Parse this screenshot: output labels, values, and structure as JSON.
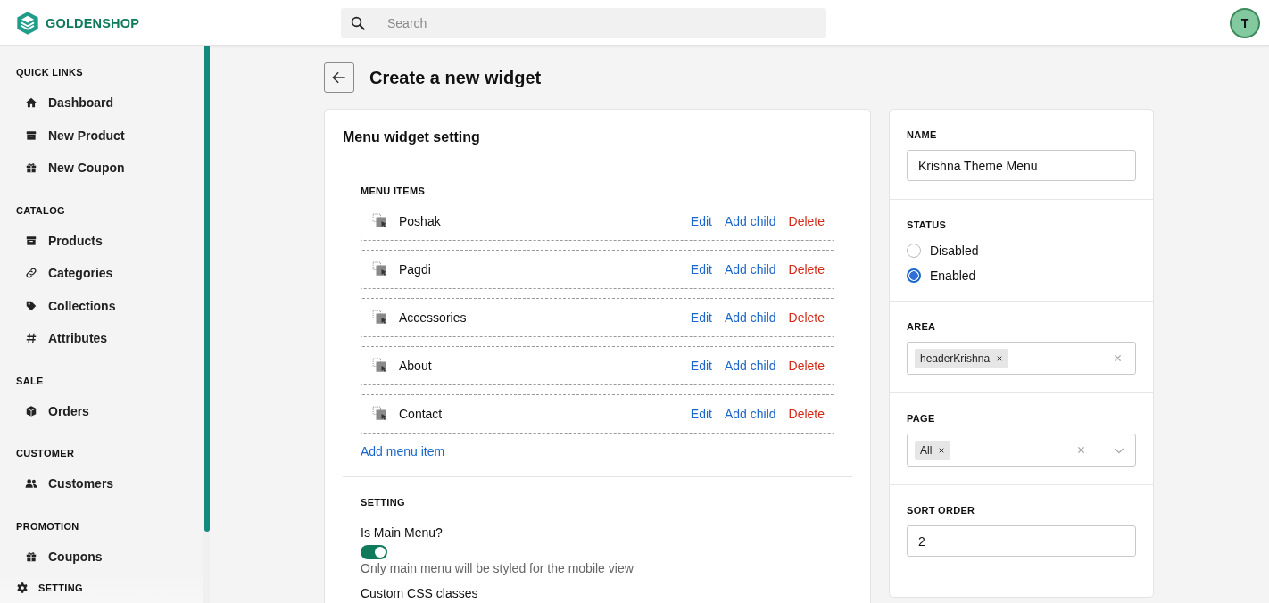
{
  "brand": {
    "name": "GOLDENSHOP"
  },
  "search": {
    "placeholder": "Search"
  },
  "user": {
    "initial": "T"
  },
  "sidebar": {
    "sections": [
      {
        "title": "QUICK LINKS",
        "items": [
          {
            "label": "Dashboard"
          },
          {
            "label": "New Product"
          },
          {
            "label": "New Coupon"
          }
        ]
      },
      {
        "title": "CATALOG",
        "items": [
          {
            "label": "Products"
          },
          {
            "label": "Categories"
          },
          {
            "label": "Collections"
          },
          {
            "label": "Attributes"
          }
        ]
      },
      {
        "title": "SALE",
        "items": [
          {
            "label": "Orders"
          }
        ]
      },
      {
        "title": "CUSTOMER",
        "items": [
          {
            "label": "Customers"
          }
        ]
      },
      {
        "title": "PROMOTION",
        "items": [
          {
            "label": "Coupons"
          }
        ]
      }
    ],
    "footer": {
      "label": "SETTING"
    }
  },
  "page": {
    "title": "Create a new widget"
  },
  "widget_setting": {
    "title": "Menu widget setting",
    "menu_items_label": "MENU ITEMS",
    "menu_items": [
      {
        "name": "Poshak",
        "actions": [
          {
            "label": "Edit",
            "kind": "edit"
          },
          {
            "label": "Add child",
            "kind": "add"
          },
          {
            "label": "Delete",
            "kind": "delete"
          }
        ]
      },
      {
        "name": "Pagdi",
        "actions": [
          {
            "label": "Edit",
            "kind": "edit"
          },
          {
            "label": "Add child",
            "kind": "add"
          },
          {
            "label": "Delete",
            "kind": "delete"
          }
        ]
      },
      {
        "name": "Accessories",
        "actions": [
          {
            "label": "Edit",
            "kind": "edit"
          },
          {
            "label": "Add child",
            "kind": "add"
          },
          {
            "label": "Delete",
            "kind": "delete"
          }
        ]
      },
      {
        "name": "About",
        "actions": [
          {
            "label": "Edit",
            "kind": "edit"
          },
          {
            "label": "Add child",
            "kind": "add"
          },
          {
            "label": "Delete",
            "kind": "delete"
          }
        ]
      },
      {
        "name": "Contact",
        "actions": [
          {
            "label": "Edit",
            "kind": "edit"
          },
          {
            "label": "Add child",
            "kind": "add"
          },
          {
            "label": "Delete",
            "kind": "delete"
          }
        ]
      }
    ],
    "add_item": "Add menu item",
    "setting": {
      "title": "SETTING",
      "main_menu": {
        "label": "Is Main Menu?",
        "on": true,
        "hint": "Only main menu will be styled for the mobile view"
      },
      "custom_css_label": "Custom CSS classes"
    }
  },
  "side_form": {
    "name": {
      "label": "NAME",
      "value": "Krishna Theme Menu"
    },
    "status": {
      "label": "STATUS",
      "options": [
        {
          "label": "Disabled",
          "selected": false
        },
        {
          "label": "Enabled",
          "selected": true
        }
      ]
    },
    "area": {
      "label": "AREA",
      "tags": [
        "headerKrishna"
      ]
    },
    "page": {
      "label": "PAGE",
      "tags": [
        "All"
      ]
    },
    "sort_order": {
      "label": "SORT ORDER",
      "value": "2"
    }
  }
}
